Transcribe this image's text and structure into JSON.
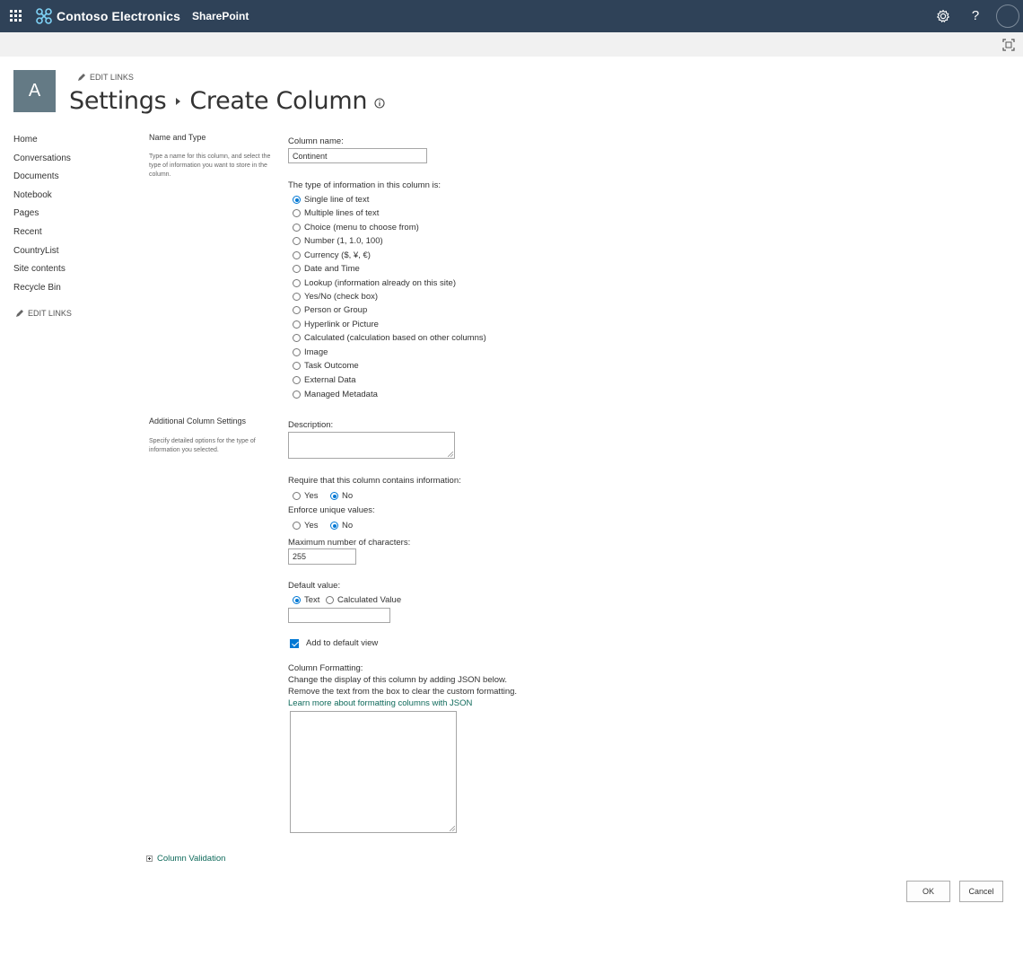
{
  "topbar": {
    "brand_name": "Contoso Electronics",
    "app_name": "SharePoint",
    "help_label": "?",
    "colors": {
      "bar": "#2f4258",
      "accent": "#0078d4",
      "link": "#0f6a5b"
    },
    "icons": [
      "app-launcher-icon",
      "contoso-logo-icon",
      "settings-gear-icon",
      "help-icon",
      "user-avatar"
    ]
  },
  "suitebar": {
    "icons": [
      "focus-mode-icon"
    ]
  },
  "site": {
    "logo_letter": "A",
    "edit_links": "EDIT LINKS"
  },
  "breadcrumb": {
    "parent": "Settings",
    "current": "Create Column"
  },
  "leftnav": {
    "items": [
      "Home",
      "Conversations",
      "Documents",
      "Notebook",
      "Pages",
      "Recent",
      "CountryList",
      "Site contents",
      "Recycle Bin"
    ],
    "edit_links": "EDIT LINKS"
  },
  "name_and_type": {
    "title": "Name and Type",
    "description": "Type a name for this column, and select the type of information you want to store in the column.",
    "column_name_label": "Column name:",
    "column_name_value": "Continent",
    "type_label": "The type of information in this column is:",
    "types": [
      "Single line of text",
      "Multiple lines of text",
      "Choice (menu to choose from)",
      "Number (1, 1.0, 100)",
      "Currency ($, ¥, €)",
      "Date and Time",
      "Lookup (information already on this site)",
      "Yes/No (check box)",
      "Person or Group",
      "Hyperlink or Picture",
      "Calculated (calculation based on other columns)",
      "Image",
      "Task Outcome",
      "External Data",
      "Managed Metadata"
    ],
    "selected_type": "Single line of text"
  },
  "additional": {
    "title": "Additional Column Settings",
    "description": "Specify detailed options for the type of information you selected.",
    "description_label": "Description:",
    "require_label": "Require that this column contains information:",
    "require_options": [
      "Yes",
      "No"
    ],
    "require_selected": "No",
    "unique_label": "Enforce unique values:",
    "unique_options": [
      "Yes",
      "No"
    ],
    "unique_selected": "No",
    "max_chars_label": "Maximum number of characters:",
    "max_chars_value": "255",
    "default_label": "Default value:",
    "default_options": [
      "Text",
      "Calculated Value"
    ],
    "default_selected": "Text",
    "default_value": "",
    "add_default_view_label": "Add to default view",
    "add_default_view_checked": true,
    "formatting_label": "Column Formatting:",
    "formatting_line1": "Change the display of this column by adding JSON below.",
    "formatting_line2": "Remove the text from the box to clear the custom formatting.",
    "formatting_link": "Learn more about formatting columns with JSON"
  },
  "validation": {
    "label": "Column Validation"
  },
  "actions": {
    "ok": "OK",
    "cancel": "Cancel"
  }
}
